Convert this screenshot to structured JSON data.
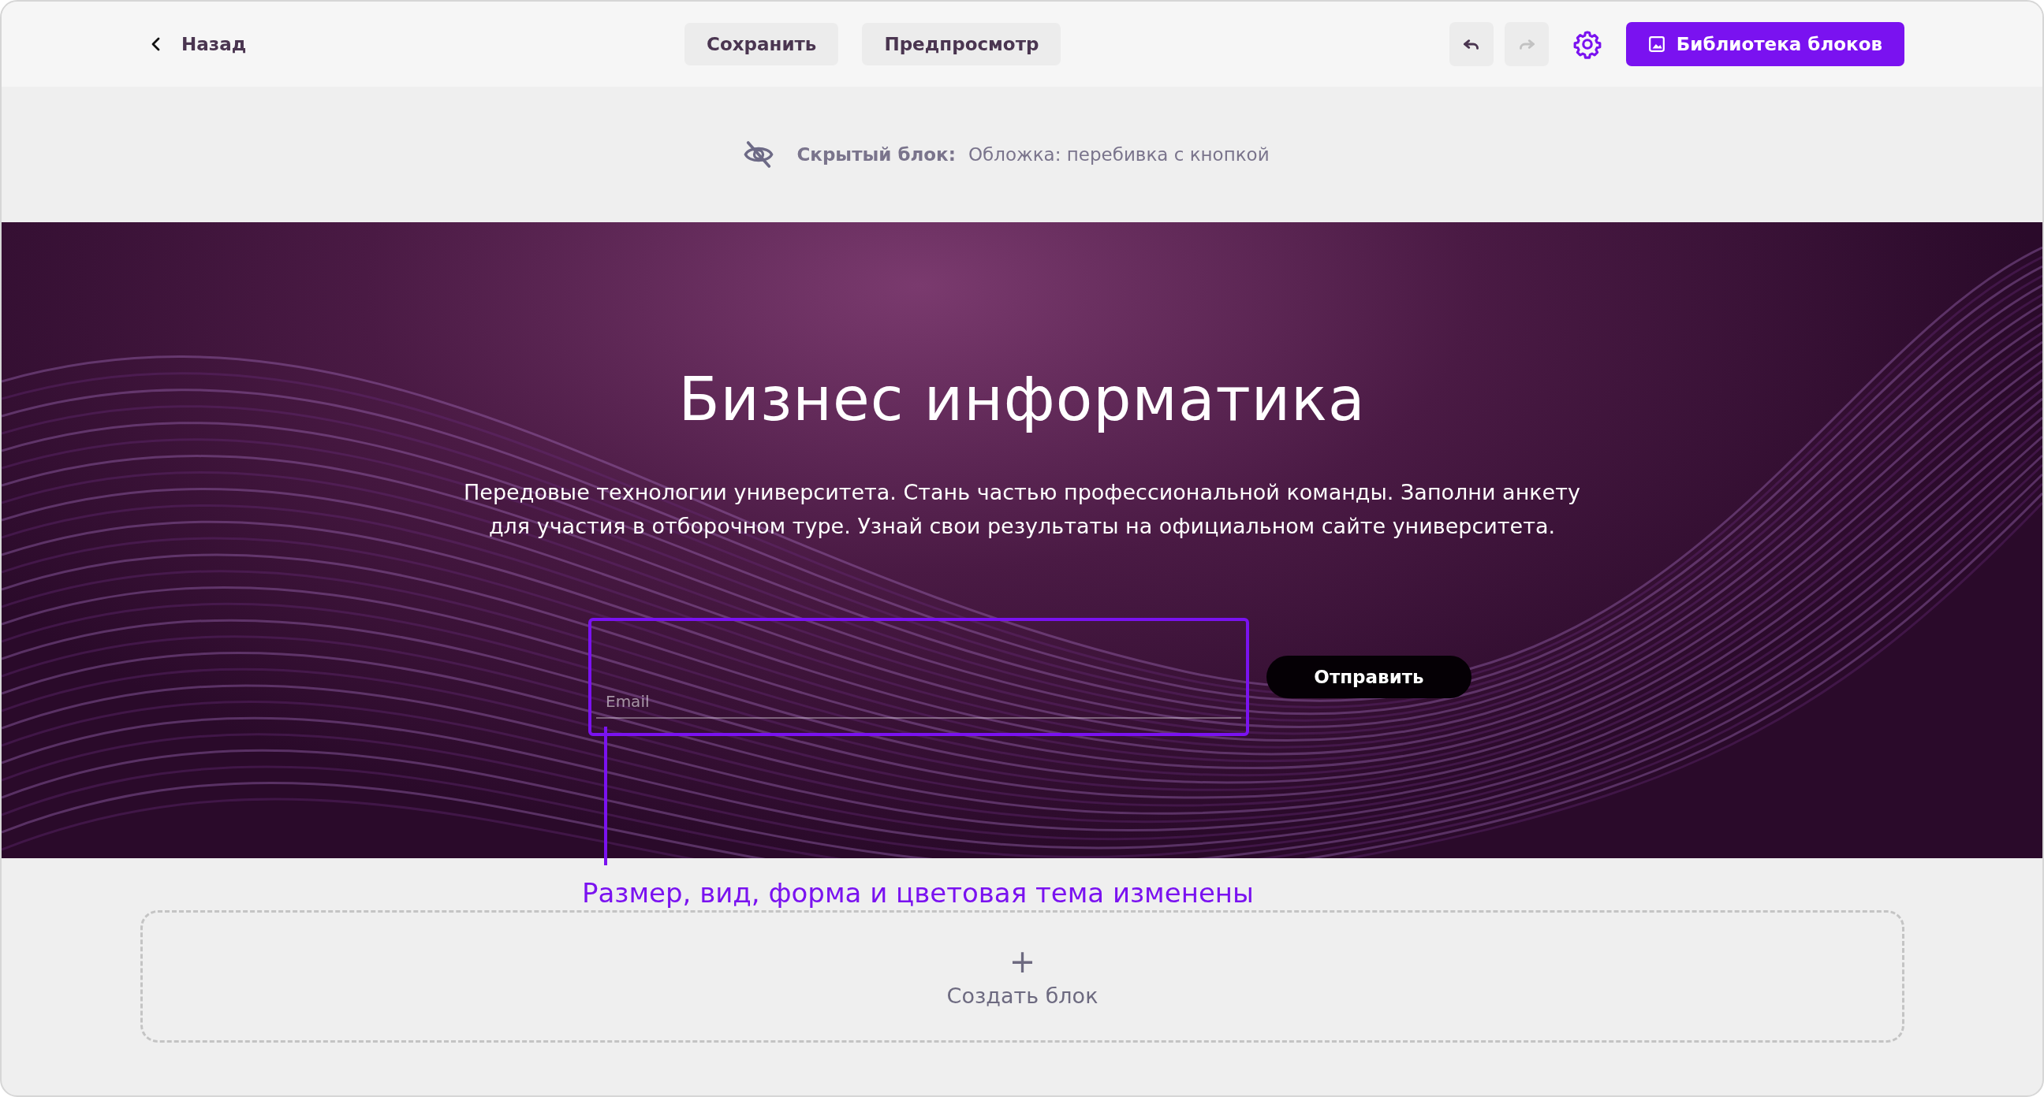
{
  "toolbar": {
    "back": {
      "label": "Назад"
    },
    "center_buttons": [
      {
        "label": "Сохранить"
      },
      {
        "label": "Предпросмотр"
      }
    ],
    "history": [
      {
        "kind": "undo",
        "disabled": false
      },
      {
        "kind": "redo",
        "disabled": true
      }
    ],
    "library_button": {
      "label": "Библиотека блоков"
    }
  },
  "hidden_notice": {
    "label": "Скрытый блок:",
    "value": "Обложка: перебивка с кнопкой"
  },
  "hero": {
    "title": "Бизнес информатика",
    "text": "Передовые технологии университета. Стань частью профессиональной команды. Заполни анкету для участия в отборочном туре. Узнай свои результаты на официальном сайте университета.",
    "email_field": {
      "placeholder": "Email"
    },
    "submit_button": {
      "label": "Отправить"
    }
  },
  "annotation": {
    "text": "Размер, вид, форма и цветовая тема изменены"
  },
  "create_block": {
    "icon": "+",
    "label": "Создать блок"
  }
}
